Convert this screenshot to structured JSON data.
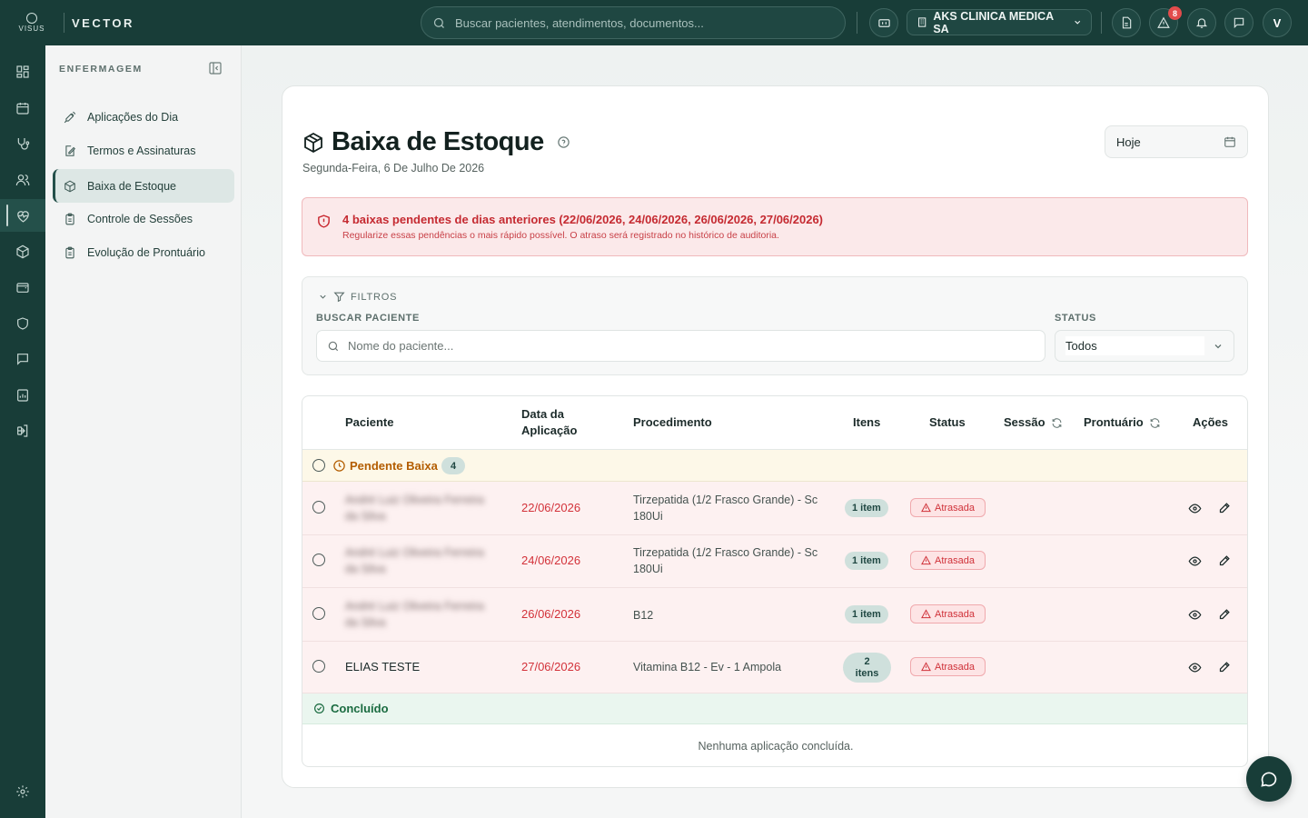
{
  "app": {
    "logo_text": "VISUS",
    "brand": "VECTOR"
  },
  "topbar": {
    "search_placeholder": "Buscar pacientes, atendimentos, documentos...",
    "clinic": "AKS CLINICA MEDICA SA",
    "alerts_count": "8",
    "avatar_initial": "V"
  },
  "rail": {
    "icons": [
      "dashboard-icon",
      "calendar-icon",
      "stethoscope-icon",
      "users-icon",
      "heart-pulse-icon",
      "box-icon",
      "wallet-icon",
      "shield-icon",
      "message-icon",
      "report-icon",
      "exit-icon",
      "settings-icon"
    ],
    "active": "heart-pulse-icon"
  },
  "sidebar": {
    "title": "ENFERMAGEM",
    "items": [
      {
        "label": "Aplicações do Dia",
        "icon": "syringe-icon"
      },
      {
        "label": "Termos e Assinaturas",
        "icon": "signature-icon"
      },
      {
        "label": "Baixa de Estoque",
        "icon": "box-icon",
        "active": true
      },
      {
        "label": "Controle de Sessões",
        "icon": "clipboard-icon"
      },
      {
        "label": "Evolução de Prontuário",
        "icon": "clipboard-icon"
      }
    ]
  },
  "page": {
    "title": "Baixa de Estoque",
    "subtitle": "Segunda-Feira, 6 De Julho De 2026",
    "date_filter": "Hoje"
  },
  "alert": {
    "title": "4 baixas pendentes de dias anteriores (22/06/2026, 24/06/2026, 26/06/2026, 27/06/2026)",
    "text": "Regularize essas pendências o mais rápido possível. O atraso será registrado no histórico de auditoria."
  },
  "filters": {
    "header": "FILTROS",
    "search_label": "BUSCAR PACIENTE",
    "search_placeholder": "Nome do paciente...",
    "status_label": "STATUS",
    "status_value": "Todos"
  },
  "table": {
    "columns": {
      "paciente": "Paciente",
      "data_l1": "Data da",
      "data_l2": "Aplicação",
      "procedimento": "Procedimento",
      "itens": "Itens",
      "status": "Status",
      "sessao": "Sessão",
      "prontuario": "Prontuário",
      "acoes": "Ações"
    },
    "groups": {
      "pending_label": "Pendente Baixa",
      "pending_count": "4",
      "done_label": "Concluído",
      "done_empty": "Nenhuma aplicação concluída."
    },
    "rows": [
      {
        "paciente": "André Luiz Oliveira Ferreira da Silva",
        "data": "22/06/2026",
        "procedimento": "Tirzepatida (1/2 Frasco Grande) - Sc 180Ui",
        "itens": "1 item",
        "status": "Atrasada"
      },
      {
        "paciente": "André Luiz Oliveira Ferreira da Silva",
        "data": "24/06/2026",
        "procedimento": "Tirzepatida (1/2 Frasco Grande) - Sc 180Ui",
        "itens": "1 item",
        "status": "Atrasada"
      },
      {
        "paciente": "André Luiz Oliveira Ferreira da Silva",
        "data": "26/06/2026",
        "procedimento": "B12",
        "itens": "1 item",
        "status": "Atrasada"
      },
      {
        "paciente": "ELIAS TESTE",
        "data": "27/06/2026",
        "procedimento": "Vitamina B12 - Ev - 1 Ampola",
        "itens": "2 itens",
        "status": "Atrasada"
      }
    ]
  },
  "colors": {
    "primary": "#183d38",
    "danger": "#d3323a",
    "pending": "#b35d00",
    "success": "#1a6b40"
  }
}
